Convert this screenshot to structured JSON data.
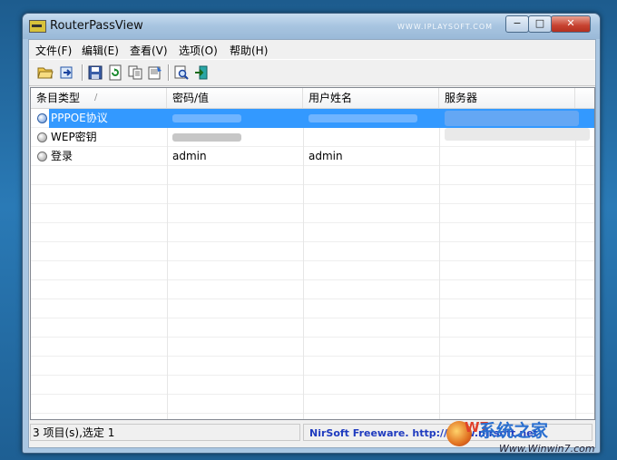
{
  "window": {
    "title": "RouterPassView",
    "watermark_top": "WWW.IPLAYSOFT.COM",
    "controls": {
      "minimize": "−",
      "maximize": "□",
      "close": "✕"
    }
  },
  "menu": [
    "文件(F)",
    "编辑(E)",
    "查看(V)",
    "选项(O)",
    "帮助(H)"
  ],
  "toolbar": {
    "icons": [
      "open-folder-icon",
      "find-icon",
      "save-icon",
      "refresh-icon",
      "copy-icon",
      "properties-icon",
      "search-icon",
      "exit-icon"
    ]
  },
  "columns": [
    "条目类型",
    "密码/值",
    "用户姓名",
    "服务器"
  ],
  "sort_indicator": "/",
  "rows": [
    {
      "type": "PPPOE协议",
      "value": "",
      "user": "",
      "server": "",
      "selected": true
    },
    {
      "type": "WEP密钥",
      "value": "",
      "user": "",
      "server": "",
      "selected": false
    },
    {
      "type": "登录",
      "value": "admin",
      "user": "admin",
      "server": "",
      "selected": false
    }
  ],
  "status": {
    "left": "3 项目(s),选定 1",
    "right": "NirSoft Freeware.  http://www.nirsoft.net"
  },
  "watermark_logo": {
    "brand": "系统之家",
    "w7": "W7",
    "site": "Www.Winwin7.com"
  },
  "colors": {
    "selection": "#3399ff",
    "link": "#1f3bbf",
    "desktop": "#2a7ab6"
  }
}
